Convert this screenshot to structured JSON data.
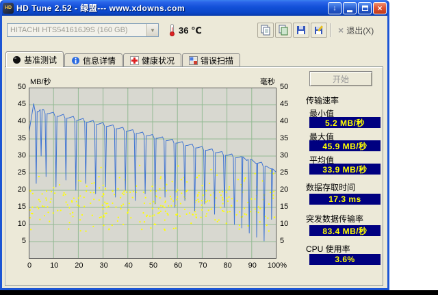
{
  "window": {
    "title": "HD Tune 2.52 - 绿盟--- www.xdowns.com",
    "controls": {
      "download_glyph": "↓",
      "close_glyph": "×"
    }
  },
  "toolbar": {
    "drive_select": {
      "value": "HITACHI HTS541616J9S (160 GB)",
      "arrow": "▼"
    },
    "temperature": "36 ℃",
    "exit_icon": "×",
    "exit_label": "退出(X)"
  },
  "tabs": [
    {
      "label": "基准测试"
    },
    {
      "label": "信息详情"
    },
    {
      "label": "健康状况"
    },
    {
      "label": "错误扫描"
    }
  ],
  "benchmark": {
    "start_button": "开始",
    "transfer_group_title": "传输速率",
    "stats": {
      "min_label": "最小值",
      "min_value": "5.2 MB/秒",
      "max_label": "最大值",
      "max_value": "45.9 MB/秒",
      "avg_label": "平均值",
      "avg_value": "33.9 MB/秒",
      "access_label": "数据存取时间",
      "access_value": "17.3 ms",
      "burst_label": "突发数据传输率",
      "burst_value": "83.4 MB/秒",
      "cpu_label": "CPU 使用率",
      "cpu_value": "3.6%"
    },
    "value_colors": {
      "bg": "#000080",
      "text": "#ffff00"
    }
  },
  "chart_data": {
    "type": "line+scatter",
    "title": "HD Tune benchmark transfer rate and access time",
    "plot_bg": "#d8d8d0",
    "grid_color": "#93ba93",
    "left_axis": {
      "label": "MB/秒",
      "min": 0,
      "max": 50,
      "step": 5,
      "ticks": [
        "50",
        "45",
        "40",
        "35",
        "30",
        "25",
        "20",
        "15",
        "10",
        "5"
      ]
    },
    "right_axis": {
      "label": "毫秒",
      "min": 0,
      "max": 50,
      "step": 5,
      "ticks": [
        "50",
        "45",
        "40",
        "35",
        "30",
        "25",
        "20",
        "15",
        "10",
        "5"
      ]
    },
    "x_axis": {
      "min": 0,
      "max": 100,
      "step": 10,
      "unit": "%",
      "ticks": [
        "0",
        "10",
        "20",
        "30",
        "40",
        "50",
        "60",
        "70",
        "80",
        "90",
        "100%"
      ]
    },
    "transfer_rate": {
      "name": "传输速率",
      "color": "#3e73d2",
      "x_step": 2,
      "values": [
        36.5,
        45.3,
        43.0,
        43.6,
        42.4,
        42.8,
        41.6,
        42.2,
        41.1,
        41.6,
        40.5,
        41.0,
        39.9,
        40.4,
        39.3,
        39.8,
        38.7,
        39.1,
        38.0,
        38.4,
        37.3,
        37.7,
        36.6,
        37.0,
        35.9,
        36.3,
        35.2,
        35.6,
        34.5,
        34.9,
        33.8,
        34.2,
        33.1,
        33.5,
        32.4,
        32.8,
        31.7,
        32.1,
        31.0,
        31.3,
        30.2,
        30.6,
        29.5,
        29.8,
        28.7,
        29.0,
        27.9,
        28.2,
        27.0,
        26.3,
        25.2
      ],
      "dips": [
        [
          3,
          22
        ],
        [
          5,
          30
        ],
        [
          7,
          24
        ],
        [
          11,
          21
        ],
        [
          15,
          23
        ],
        [
          19,
          20
        ],
        [
          23,
          22
        ],
        [
          27,
          19
        ],
        [
          31,
          21
        ],
        [
          35,
          18
        ],
        [
          39,
          20
        ],
        [
          43,
          17
        ],
        [
          47,
          19
        ],
        [
          51,
          16
        ],
        [
          55,
          18
        ],
        [
          59,
          15
        ],
        [
          63,
          17
        ],
        [
          67,
          14
        ],
        [
          71,
          16
        ],
        [
          75,
          13
        ],
        [
          79,
          15
        ],
        [
          83,
          10
        ],
        [
          86,
          9
        ],
        [
          89,
          7.5
        ],
        [
          92,
          6.3
        ],
        [
          95,
          5.2
        ],
        [
          98,
          11.5
        ]
      ]
    },
    "access_time_scatter": {
      "name": "数据存取时间",
      "color": "#ffff00",
      "count": 320,
      "x_range": [
        0.5,
        99.5
      ],
      "ms_range": [
        8,
        24
      ]
    }
  }
}
